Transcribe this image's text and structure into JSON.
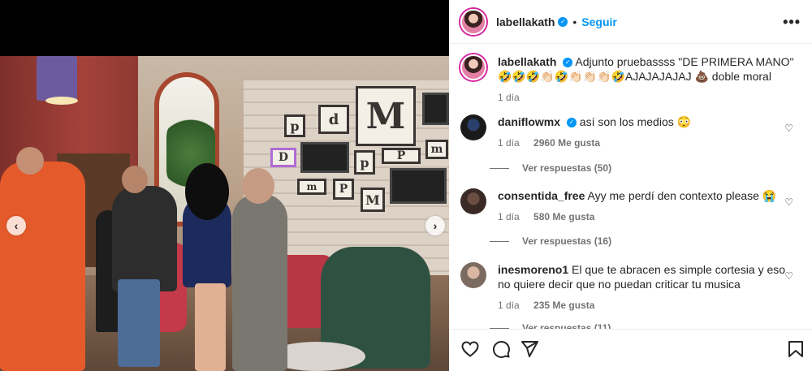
{
  "post": {
    "author": "labellakath",
    "follow_label": "Seguir",
    "separator": "•",
    "more_label": "•••"
  },
  "caption": {
    "author": "labellakath",
    "text": "Adjunto pruebassss \"DE PRIMERA MANO\" 🤣🤣🤣👏🏻🤣👏🏻👏🏻👏🏻🤣AJAJAJAJAJ 💩 doble moral",
    "time": "1 día"
  },
  "comments": [
    {
      "author": "daniflowmx",
      "verified": true,
      "text": "así son los medios 😳",
      "time": "1 día",
      "likes": "2960 Me gusta",
      "replies": "Ver respuestas (50)"
    },
    {
      "author": "consentida_free",
      "verified": false,
      "text": "Ayy me perdí den contexto please 😭",
      "time": "1 día",
      "likes": "580 Me gusta",
      "replies": "Ver respuestas (16)"
    },
    {
      "author": "inesmoreno1",
      "verified": false,
      "text": "El que te abracen es simple cortesia y eso no quiere decir que no puedan criticar tu musica",
      "time": "1 día",
      "likes": "235 Me gusta",
      "replies": "Ver respuestas (11)"
    }
  ],
  "icons": {
    "prev": "chevron-left-icon",
    "next": "chevron-right-icon",
    "like": "heart-icon",
    "comment": "comment-icon",
    "share": "send-icon",
    "save": "bookmark-icon",
    "more": "more-icon"
  },
  "photo_text": {
    "frame_p1": "p",
    "frame_d": "d",
    "frame_M": "M",
    "frame_D": "D",
    "frame_p2": "p",
    "frame_P": "P",
    "frame_m": "m",
    "frame_p3": "p",
    "frame_m2": "m",
    "frame_P2": "P",
    "frame_M2": "M"
  }
}
